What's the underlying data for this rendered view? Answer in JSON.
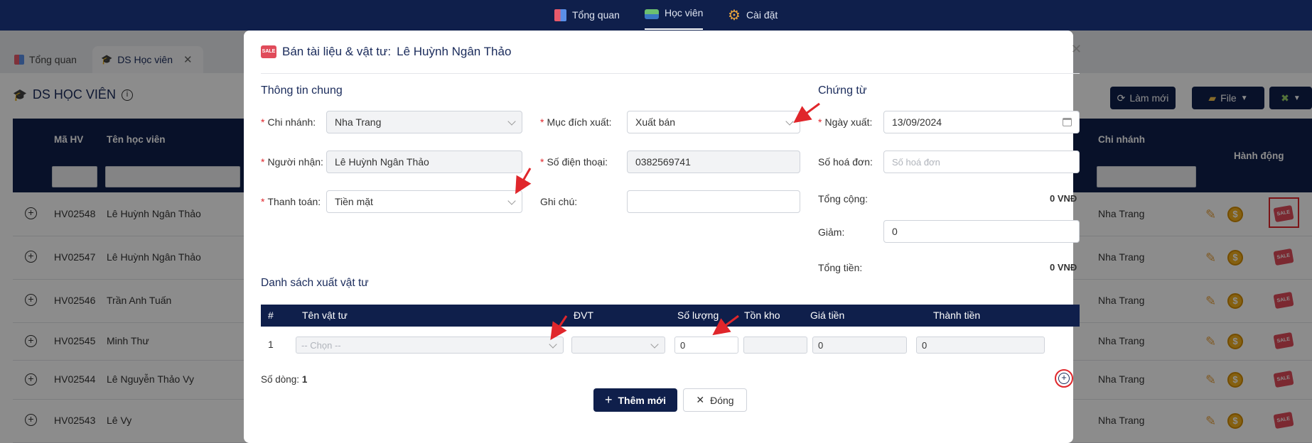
{
  "topnav": {
    "items": [
      {
        "label": "Tổng quan",
        "icon": "dashboard-icon"
      },
      {
        "label": "Học viên",
        "icon": "student-icon"
      },
      {
        "label": "Cài đặt",
        "icon": "gear-icon"
      }
    ]
  },
  "tabs": [
    {
      "label": "Tổng quan"
    },
    {
      "label": "DS Học viên"
    }
  ],
  "page": {
    "title": "DS HỌC VIÊN",
    "buttons": {
      "refresh": "Làm mới",
      "file": "File"
    }
  },
  "grid": {
    "columns": [
      "Mã HV",
      "Tên học viên",
      "Chi nhánh",
      "Hành động"
    ],
    "rows": [
      {
        "id": "HV02548",
        "name": "Lê Huỳnh Ngân Thảo",
        "branch": "Nha Trang"
      },
      {
        "id": "HV02547",
        "name": "Lê Huỳnh Ngân Thảo",
        "branch": "Nha Trang"
      },
      {
        "id": "HV02546",
        "name": "Trần Anh Tuấn",
        "branch": "Nha Trang"
      },
      {
        "id": "HV02545",
        "name": "Minh Thư",
        "branch": "Nha Trang"
      },
      {
        "id": "HV02544",
        "name": "Lê Nguyễn Thảo Vy",
        "branch": "Nha Trang"
      },
      {
        "id": "HV02543",
        "name": "Lê Vy",
        "branch": "Nha Trang"
      }
    ]
  },
  "modal": {
    "title_prefix": "Bán tài liệu & vật tư:",
    "title_name": "Lê Huỳnh Ngân Thảo",
    "general_section": "Thông tin chung",
    "voucher_section": "Chứng từ",
    "fields": {
      "branch_label": "Chi nhánh:",
      "branch_value": "Nha Trang",
      "purpose_label": "Mục đích xuất:",
      "purpose_value": "Xuất bán",
      "date_label": "Ngày xuất:",
      "date_value": "13/09/2024",
      "receiver_label": "Người nhận:",
      "receiver_value": "Lê Huỳnh Ngân Thảo",
      "phone_label": "Số điện thoại:",
      "phone_value": "0382569741",
      "invoice_label": "Số hoá đơn:",
      "invoice_placeholder": "Số hoá đơn",
      "payment_label": "Thanh toán:",
      "payment_value": "Tiền mặt",
      "note_label": "Ghi chú:",
      "note_value": "",
      "total_label": "Tổng cộng:",
      "total_value": "0 VNĐ",
      "discount_label": "Giảm:",
      "discount_value": "0",
      "grand_total_label": "Tổng tiền:",
      "grand_total_value": "0 VNĐ"
    },
    "list_section": "Danh sách xuất vật tư",
    "table": {
      "headers": [
        "#",
        "Tên vật tư",
        "ĐVT",
        "Số lượng",
        "Tồn kho",
        "Giá tiền",
        "Thành tiền"
      ],
      "row": {
        "index": "1",
        "item_placeholder": "-- Chọn --",
        "unit": "",
        "qty": "0",
        "stock": "",
        "price": "0",
        "amount": "0"
      }
    },
    "row_count_label": "Số dòng:",
    "row_count_value": "1",
    "add_button": "Thêm mới",
    "close_button": "Đóng"
  },
  "colors": {
    "navy": "#0f1f4b",
    "required": "#e0262b",
    "annotation": "#e0262b"
  }
}
